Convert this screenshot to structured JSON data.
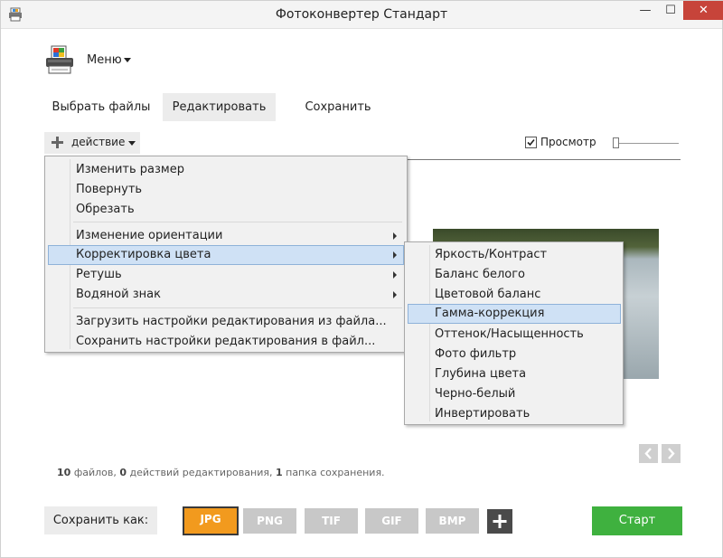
{
  "window": {
    "title": "Фотоконвертер Стандарт",
    "controls": {
      "minimize": "—",
      "maximize": "☐",
      "close": "✕"
    }
  },
  "header": {
    "menu_label": "Меню"
  },
  "tabs": [
    {
      "label": "Выбрать файлы",
      "active": false
    },
    {
      "label": "Редактировать",
      "active": true
    },
    {
      "label": "Сохранить",
      "active": false
    }
  ],
  "action_bar": {
    "action_label": "действие",
    "preview_label": "Просмотр",
    "preview_checked": true
  },
  "context_menu": {
    "items": [
      {
        "label": "Изменить размер",
        "submenu": false
      },
      {
        "label": "Повернуть",
        "submenu": false
      },
      {
        "label": "Обрезать",
        "submenu": false
      },
      {
        "label": "Изменение ориентации",
        "submenu": true
      },
      {
        "label": "Корректировка цвета",
        "submenu": true,
        "highlighted": true
      },
      {
        "label": "Ретушь",
        "submenu": true
      },
      {
        "label": "Водяной знак",
        "submenu": true
      },
      {
        "label": "Загрузить настройки редактирования из файла...",
        "submenu": false
      },
      {
        "label": "Сохранить настройки редактирования в файл...",
        "submenu": false
      }
    ]
  },
  "submenu": {
    "items": [
      {
        "label": "Яркость/Контраст"
      },
      {
        "label": "Баланс белого"
      },
      {
        "label": "Цветовой баланс"
      },
      {
        "label": "Гамма-коррекция",
        "highlighted": true
      },
      {
        "label": "Оттенок/Насыщенность"
      },
      {
        "label": "Фото фильтр"
      },
      {
        "label": "Глубина цвета"
      },
      {
        "label": "Черно-белый"
      },
      {
        "label": "Инвертировать"
      }
    ]
  },
  "status": {
    "files_count": "10",
    "files_text": "файлов,",
    "edits_count": "0",
    "edits_text": "действий редактирования,",
    "folders_count": "1",
    "folders_text": "папка сохранения."
  },
  "bottom": {
    "save_as_label": "Сохранить как:",
    "formats": [
      {
        "label": "JPG",
        "active": true
      },
      {
        "label": "PNG",
        "active": false
      },
      {
        "label": "TIF",
        "active": false
      },
      {
        "label": "GIF",
        "active": false
      },
      {
        "label": "BMP",
        "active": false
      }
    ],
    "start_label": "Старт"
  },
  "colors": {
    "accent_orange": "#f29a1e",
    "start_green": "#3fb13f",
    "highlight_blue": "#cfe1f5",
    "close_red": "#c7443a"
  }
}
